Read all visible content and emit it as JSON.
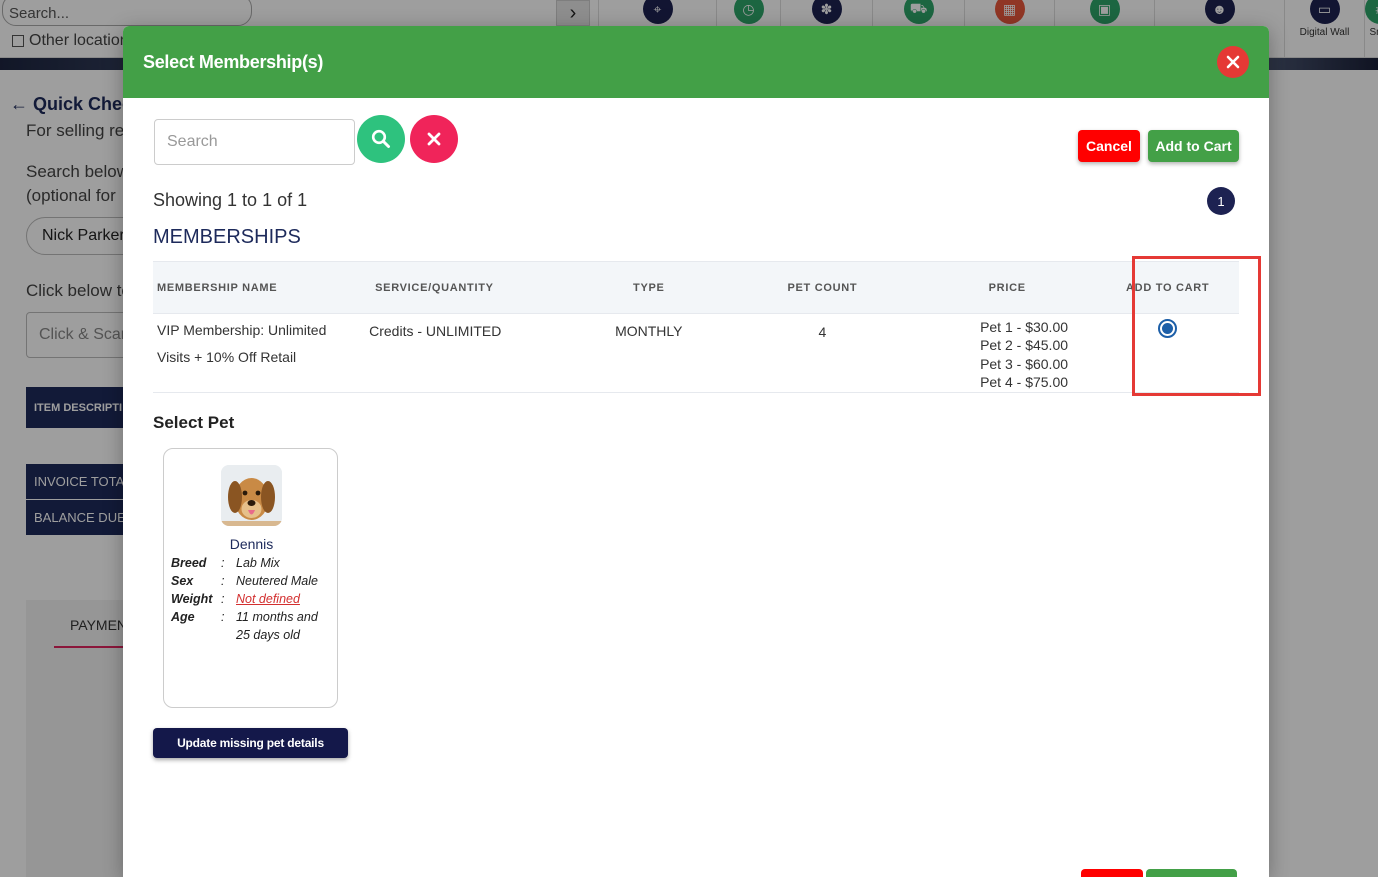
{
  "background": {
    "search_placeholder": "Search...",
    "other_location_label": "Other location",
    "nav_icons": [
      {
        "icon": "map-pin-icon",
        "color": "#1d2252",
        "label": ""
      },
      {
        "icon": "clock-icon",
        "color": "#2ea56a",
        "label": ""
      },
      {
        "icon": "paw-icon",
        "color": "#1d2252",
        "label": ""
      },
      {
        "icon": "cart-icon",
        "color": "#2ea56a",
        "label": ""
      },
      {
        "icon": "calendar-icon",
        "color": "#e8583c",
        "label": ""
      },
      {
        "icon": "calendar-add-icon",
        "color": "#2ea56a",
        "label": ""
      },
      {
        "icon": "user-add-icon",
        "color": "#1d2252",
        "label": ""
      },
      {
        "icon": "monitor-icon",
        "color": "#1d2252",
        "label": "Digital Wall"
      },
      {
        "icon": "hash-icon",
        "color": "#2ea56a",
        "label": "Snip"
      }
    ],
    "back_title": "Quick Chec",
    "subtitle": "For selling re",
    "search_below": "Search below",
    "optional_for": "(optional for",
    "customer": "Nick Parker",
    "click_below": "Click below to",
    "scan_placeholder": "Click & Scan",
    "item_description": "ITEM DESCRIPTI",
    "invoice_total": "INVOICE TOTAL",
    "balance_due": "BALANCE DUE",
    "payment_tab": "PAYMEN"
  },
  "modal": {
    "title": "Select Membership(s)",
    "search_placeholder": "Search",
    "cancel_label": "Cancel",
    "add_to_cart_label": "Add to Cart",
    "showing_text": "Showing 1 to 1 of 1",
    "page_number": "1",
    "section_title": "MEMBERSHIPS",
    "columns": {
      "name": "MEMBERSHIP NAME",
      "service": "SERVICE/QUANTITY",
      "type": "TYPE",
      "pet_count": "PET COUNT",
      "price": "PRICE",
      "add_to_cart": "ADD TO CART"
    },
    "rows": [
      {
        "name": "VIP Membership: Unlimited Visits + 10% Off Retail",
        "service": "Credits - UNLIMITED",
        "type": "MONTHLY",
        "pet_count": "4",
        "prices": [
          "Pet 1 - $30.00",
          "Pet 2 - $45.00",
          "Pet 3 - $60.00",
          "Pet 4 - $75.00"
        ],
        "selected": true
      }
    ],
    "select_pet_title": "Select Pet",
    "pet": {
      "name": "Dennis",
      "breed_label": "Breed",
      "breed": "Lab Mix",
      "sex_label": "Sex",
      "sex": "Neutered Male",
      "weight_label": "Weight",
      "weight": "Not defined",
      "age_label": "Age",
      "age": "11 months and 25 days old",
      "separator": ":"
    },
    "update_button": "Update missing pet details"
  },
  "colors": {
    "header_green": "#43a047",
    "navy": "#1d2a5b",
    "cancel_red": "#ff0000",
    "search_green": "#2ec27e",
    "clear_pink": "#f0245a",
    "highlight_red": "#e53935"
  }
}
